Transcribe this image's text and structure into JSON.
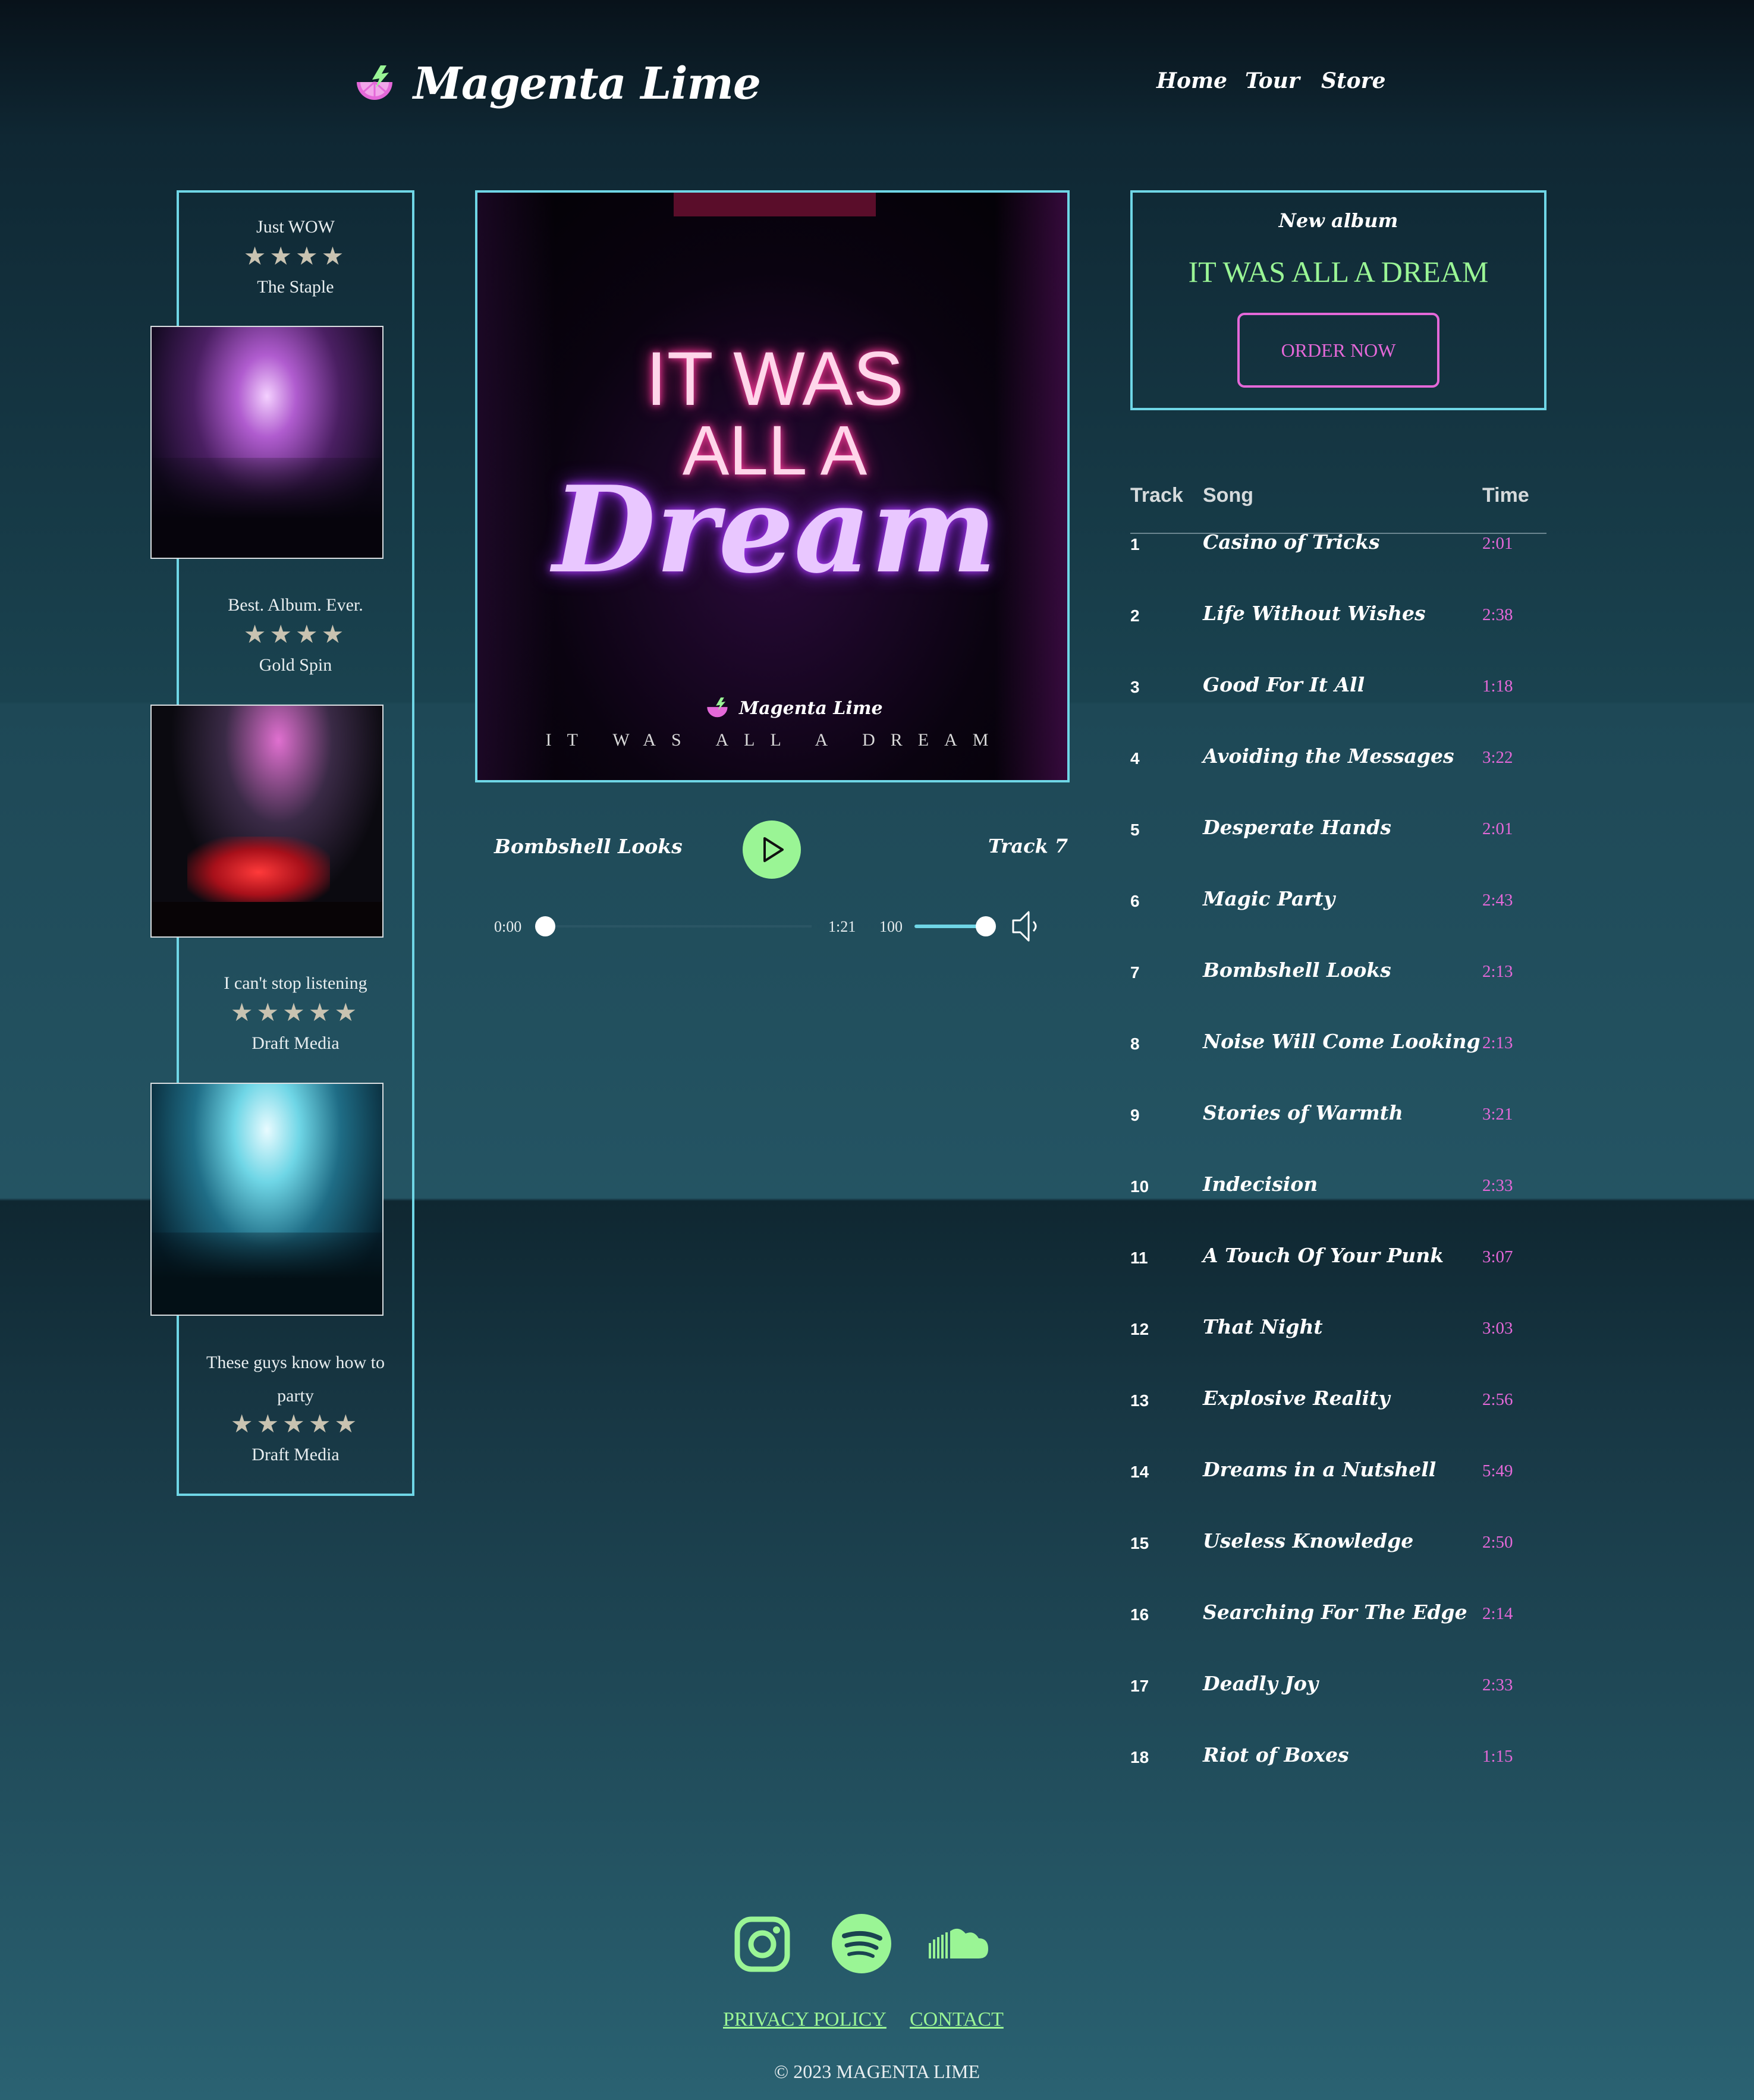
{
  "brand": {
    "name": "Magenta Lime",
    "lime": "#9af595",
    "magenta": "#e468d8",
    "cyan": "#6fd6e6"
  },
  "nav": [
    {
      "label": "Home"
    },
    {
      "label": "Tour"
    },
    {
      "label": "Store"
    }
  ],
  "reviews": [
    {
      "quote": "Just WOW",
      "stars": 4,
      "source": "The Staple"
    },
    {
      "quote": "Best. Album. Ever.",
      "stars": 4,
      "source": "Gold Spin"
    },
    {
      "quote": "I can't stop listening",
      "stars": 5,
      "source": "Draft Media"
    },
    {
      "quote": "These guys know how to party",
      "stars": 5,
      "source": "Draft Media"
    }
  ],
  "album_art": {
    "line1": "IT WAS",
    "line2": "ALL A",
    "line3": "Dream",
    "band": "Magenta Lime",
    "subtitle": "IT WAS ALL A DREAM"
  },
  "player": {
    "song": "Bombshell Looks",
    "track": "Track 7",
    "elapsed": "0:00",
    "duration": "1:21",
    "progress": 0,
    "volume_label": "100",
    "volume": 1
  },
  "promo": {
    "kicker": "New album",
    "title": "IT WAS ALL A DREAM",
    "button": "ORDER NOW"
  },
  "tracklist": {
    "headers": {
      "track": "Track",
      "song": "Song",
      "time": "Time"
    },
    "rows": [
      {
        "n": "1",
        "title": "Casino of Tricks",
        "time": "2:01"
      },
      {
        "n": "2",
        "title": "Life Without Wishes",
        "time": "2:38"
      },
      {
        "n": "3",
        "title": "Good For It All",
        "time": "1:18"
      },
      {
        "n": "4",
        "title": "Avoiding the Messages",
        "time": "3:22"
      },
      {
        "n": "5",
        "title": "Desperate Hands",
        "time": "2:01"
      },
      {
        "n": "6",
        "title": "Magic Party",
        "time": "2:43"
      },
      {
        "n": "7",
        "title": "Bombshell Looks",
        "time": "2:13"
      },
      {
        "n": "8",
        "title": "Noise Will Come Looking",
        "time": "2:13"
      },
      {
        "n": "9",
        "title": "Stories of Warmth",
        "time": "3:21"
      },
      {
        "n": "10",
        "title": "Indecision",
        "time": "2:33"
      },
      {
        "n": "11",
        "title": "A Touch Of Your Punk",
        "time": "3:07"
      },
      {
        "n": "12",
        "title": "That Night",
        "time": "3:03"
      },
      {
        "n": "13",
        "title": "Explosive Reality",
        "time": "2:56"
      },
      {
        "n": "14",
        "title": "Dreams in a Nutshell",
        "time": "5:49"
      },
      {
        "n": "15",
        "title": "Useless Knowledge",
        "time": "2:50"
      },
      {
        "n": "16",
        "title": "Searching For The Edge",
        "time": "2:14"
      },
      {
        "n": "17",
        "title": "Deadly Joy",
        "time": "2:33"
      },
      {
        "n": "18",
        "title": "Riot of Boxes",
        "time": "1:15"
      }
    ]
  },
  "social": [
    {
      "icon": "instagram-icon"
    },
    {
      "icon": "spotify-icon"
    },
    {
      "icon": "soundcloud-icon"
    }
  ],
  "footer": {
    "privacy": "PRIVACY POLICY",
    "contact": "CONTACT",
    "copyright": "© 2023 MAGENTA LIME"
  }
}
